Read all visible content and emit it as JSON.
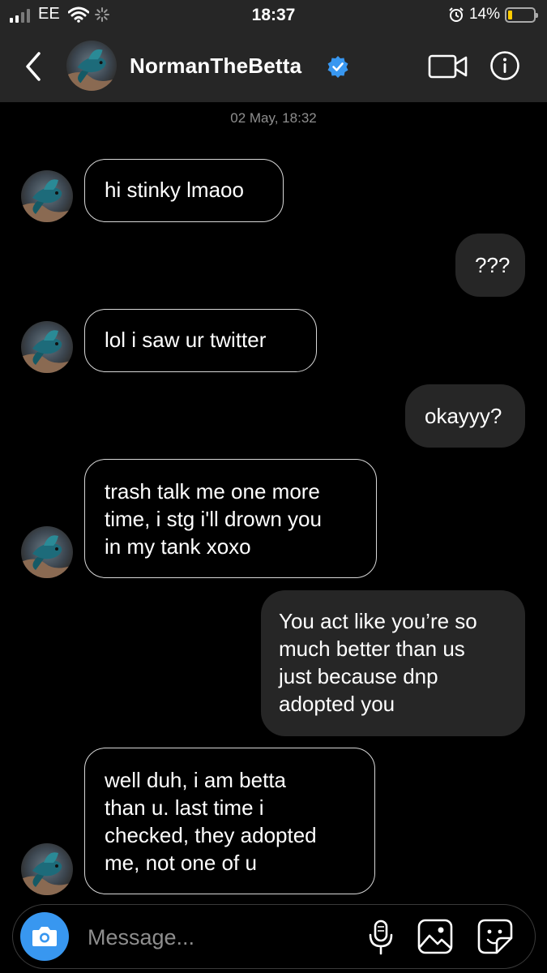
{
  "status_bar": {
    "carrier": "EE",
    "time": "18:37",
    "battery_percent": "14%",
    "battery_level": 0.14,
    "colors": {
      "battery_fill": "#ffcc00"
    }
  },
  "header": {
    "username": "NormanTheBetta",
    "verified": true,
    "colors": {
      "verified_badge": "#3897f0",
      "background": "#262626"
    }
  },
  "chat": {
    "timestamp": "02 May, 18:32",
    "messages": [
      {
        "direction": "incoming",
        "text": "hi stinky lmaoo"
      },
      {
        "direction": "outgoing",
        "text": "???"
      },
      {
        "direction": "incoming",
        "text": "lol i saw ur twitter"
      },
      {
        "direction": "outgoing",
        "text": "okayyy?"
      },
      {
        "direction": "incoming",
        "text": "trash talk me one more\ntime, i stg i'll drown you\nin my tank xoxo"
      },
      {
        "direction": "outgoing",
        "text": "You act like you’re so\nmuch better than us\njust because dnp\nadopted you"
      },
      {
        "direction": "incoming",
        "text": "well duh, i am betta\nthan u. last time i\nchecked, they adopted\nme, not one of u"
      }
    ]
  },
  "composer": {
    "placeholder": "Message...",
    "icons": [
      "camera-icon",
      "microphone-icon",
      "gallery-icon",
      "sticker-icon"
    ],
    "colors": {
      "camera_button": "#3897f0"
    }
  }
}
